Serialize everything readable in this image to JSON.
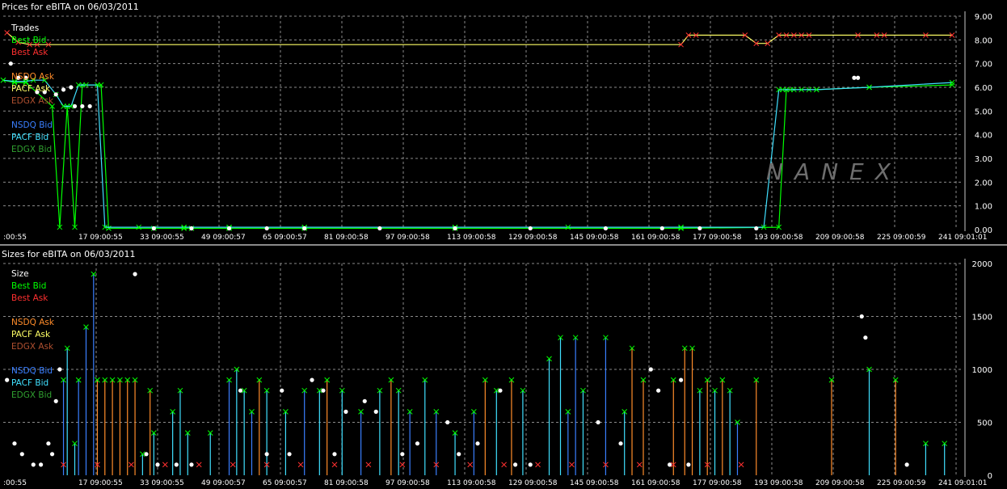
{
  "colors": {
    "trades": "#ffffff",
    "best_bid": "#00ff00",
    "best_ask": "#ff3030",
    "nsdq_ask": "#ff8c2a",
    "pacf_ask": "#ffff66",
    "edgx_ask": "#b05030",
    "nsdq_bid": "#3a7fff",
    "pacf_bid": "#40e0ff",
    "edgx_bid": "#30a030"
  },
  "watermark": "NANEX",
  "chart_data": [
    {
      "type": "line",
      "title": "Prices for  eBITA  on  06/03/2011",
      "x_ticks": [
        ":00:55",
        "17 09:00:55",
        "33 09:00:55",
        "49 09:00:57",
        "65 09:00:57",
        "81 09:00:58",
        "97 09:00:58",
        "113 09:00:58",
        "129 09:00:58",
        "145 09:00:58",
        "161 09:00:58",
        "177 09:00:58",
        "193 09:00:58",
        "209 09:00:58",
        "225 09:00:59",
        "241 09:01:01"
      ],
      "y_ticks": [
        "0.00",
        "1.00",
        "2.00",
        "3.00",
        "4.00",
        "5.00",
        "6.00",
        "7.00",
        "8.00",
        "9.00"
      ],
      "ylim": [
        0,
        9
      ],
      "xlim": [
        0,
        255
      ],
      "legend": [
        "Trades",
        "Best Bid",
        "Best Ask",
        "NSDQ Ask",
        "PACF Ask",
        "EDGX Ask",
        "NSDQ Bid",
        "PACF Bid",
        "EDGX Bid"
      ],
      "legend_placement": "top-left",
      "grid": true,
      "series": [
        {
          "name": "Best Ask",
          "x": [
            1,
            4,
            7,
            9,
            12,
            180,
            182,
            184,
            197,
            200,
            203,
            206,
            208,
            210,
            212,
            214,
            227,
            232,
            234,
            245,
            252
          ],
          "y": [
            8.3,
            7.9,
            7.8,
            7.8,
            7.8,
            7.8,
            8.2,
            8.2,
            8.2,
            7.85,
            7.85,
            8.2,
            8.2,
            8.2,
            8.2,
            8.2,
            8.2,
            8.2,
            8.2,
            8.2,
            8.2
          ]
        },
        {
          "name": "Best Bid",
          "x": [
            0,
            3,
            6,
            13,
            15,
            17,
            19,
            21,
            26,
            28,
            40,
            48,
            50,
            60,
            80,
            120,
            180,
            206,
            208,
            210,
            214,
            216,
            230,
            252
          ],
          "y": [
            6.3,
            6.2,
            6.2,
            5.2,
            0.1,
            5.2,
            0.1,
            6.1,
            6.1,
            0.05,
            0.05,
            0.05,
            0.05,
            0.05,
            0.05,
            0.05,
            0.05,
            0.1,
            5.9,
            5.9,
            5.9,
            5.9,
            6.0,
            6.1
          ]
        },
        {
          "name": "PACF Bid",
          "x": [
            0,
            3,
            6,
            8,
            11,
            14,
            16,
            18,
            20,
            22,
            25,
            27,
            36,
            48,
            60,
            80,
            120,
            150,
            180,
            202,
            206,
            207,
            209,
            212,
            216,
            230,
            252
          ],
          "y": [
            6.3,
            6.25,
            6.25,
            6.3,
            6.3,
            5.7,
            5.2,
            5.2,
            6.1,
            6.1,
            6.1,
            0.1,
            0.1,
            0.1,
            0.1,
            0.1,
            0.1,
            0.1,
            0.1,
            0.1,
            5.9,
            5.9,
            5.9,
            5.9,
            5.9,
            6.0,
            6.2
          ]
        },
        {
          "name": "Trades",
          "x": [
            2,
            4,
            6,
            9,
            11,
            14,
            16,
            18,
            19,
            21,
            23,
            40,
            50,
            60,
            70,
            80,
            100,
            120,
            140,
            160,
            175,
            185,
            200,
            226,
            227
          ],
          "y": [
            7.0,
            6.4,
            6.4,
            5.8,
            5.8,
            5.7,
            5.9,
            6.0,
            5.2,
            5.2,
            5.2,
            0.05,
            0.05,
            0.05,
            0.05,
            0.05,
            0.05,
            0.05,
            0.05,
            0.05,
            0.05,
            0.05,
            0.05,
            6.4,
            6.4
          ]
        }
      ]
    },
    {
      "type": "bar",
      "title": "Sizes for  eBITA  on  06/03/2011",
      "x_ticks": [
        ":00:55",
        "17 09:00:55",
        "33 09:00:55",
        "49 09:00:57",
        "65 09:00:57",
        "81 09:00:58",
        "97 09:00:58",
        "113 09:00:58",
        "129 09:00:58",
        "145 09:00:58",
        "161 09:00:58",
        "177 09:00:58",
        "193 09:00:58",
        "209 09:00:58",
        "225 09:00:59",
        "241 09:01:01"
      ],
      "y_ticks": [
        "0",
        "500",
        "1000",
        "1500",
        "2000"
      ],
      "ylim": [
        0,
        2000
      ],
      "xlim": [
        0,
        255
      ],
      "legend": [
        "Size",
        "Best Bid",
        "Best Ask",
        "NSDQ Ask",
        "PACF Ask",
        "EDGX Ask",
        "NSDQ Bid",
        "PACF Bid",
        "EDGX Bid"
      ],
      "legend_placement": "top-left",
      "grid": true,
      "bars": [
        {
          "x": 16,
          "y": 900,
          "s": "nsdq_bid"
        },
        {
          "x": 17,
          "y": 1200,
          "s": "pacf_bid"
        },
        {
          "x": 19,
          "y": 300,
          "s": "pacf_bid"
        },
        {
          "x": 20,
          "y": 900,
          "s": "nsdq_bid"
        },
        {
          "x": 22,
          "y": 1400,
          "s": "nsdq_bid"
        },
        {
          "x": 24,
          "y": 1900,
          "s": "nsdq_bid"
        },
        {
          "x": 25,
          "y": 900,
          "s": "nsdq_ask"
        },
        {
          "x": 27,
          "y": 900,
          "s": "nsdq_ask"
        },
        {
          "x": 29,
          "y": 900,
          "s": "nsdq_ask"
        },
        {
          "x": 31,
          "y": 900,
          "s": "nsdq_ask"
        },
        {
          "x": 33,
          "y": 900,
          "s": "nsdq_ask"
        },
        {
          "x": 35,
          "y": 900,
          "s": "nsdq_ask"
        },
        {
          "x": 37,
          "y": 200,
          "s": "pacf_bid"
        },
        {
          "x": 39,
          "y": 800,
          "s": "nsdq_ask"
        },
        {
          "x": 40,
          "y": 400,
          "s": "pacf_bid"
        },
        {
          "x": 45,
          "y": 600,
          "s": "pacf_bid"
        },
        {
          "x": 47,
          "y": 800,
          "s": "pacf_bid"
        },
        {
          "x": 49,
          "y": 400,
          "s": "pacf_bid"
        },
        {
          "x": 55,
          "y": 400,
          "s": "pacf_bid"
        },
        {
          "x": 60,
          "y": 900,
          "s": "nsdq_bid"
        },
        {
          "x": 62,
          "y": 1000,
          "s": "pacf_bid"
        },
        {
          "x": 64,
          "y": 800,
          "s": "pacf_bid"
        },
        {
          "x": 66,
          "y": 600,
          "s": "nsdq_bid"
        },
        {
          "x": 68,
          "y": 900,
          "s": "nsdq_ask"
        },
        {
          "x": 70,
          "y": 800,
          "s": "pacf_bid"
        },
        {
          "x": 75,
          "y": 600,
          "s": "pacf_bid"
        },
        {
          "x": 80,
          "y": 800,
          "s": "nsdq_bid"
        },
        {
          "x": 84,
          "y": 800,
          "s": "pacf_bid"
        },
        {
          "x": 86,
          "y": 900,
          "s": "nsdq_ask"
        },
        {
          "x": 90,
          "y": 800,
          "s": "pacf_bid"
        },
        {
          "x": 95,
          "y": 600,
          "s": "nsdq_bid"
        },
        {
          "x": 100,
          "y": 800,
          "s": "pacf_bid"
        },
        {
          "x": 103,
          "y": 900,
          "s": "nsdq_ask"
        },
        {
          "x": 105,
          "y": 800,
          "s": "pacf_bid"
        },
        {
          "x": 108,
          "y": 600,
          "s": "nsdq_bid"
        },
        {
          "x": 112,
          "y": 900,
          "s": "pacf_bid"
        },
        {
          "x": 115,
          "y": 600,
          "s": "nsdq_bid"
        },
        {
          "x": 120,
          "y": 400,
          "s": "pacf_bid"
        },
        {
          "x": 125,
          "y": 600,
          "s": "nsdq_bid"
        },
        {
          "x": 128,
          "y": 900,
          "s": "nsdq_ask"
        },
        {
          "x": 131,
          "y": 800,
          "s": "pacf_bid"
        },
        {
          "x": 135,
          "y": 900,
          "s": "nsdq_ask"
        },
        {
          "x": 138,
          "y": 800,
          "s": "pacf_bid"
        },
        {
          "x": 145,
          "y": 1100,
          "s": "pacf_bid"
        },
        {
          "x": 148,
          "y": 1300,
          "s": "pacf_bid"
        },
        {
          "x": 150,
          "y": 600,
          "s": "nsdq_bid"
        },
        {
          "x": 152,
          "y": 1300,
          "s": "nsdq_bid"
        },
        {
          "x": 154,
          "y": 800,
          "s": "pacf_bid"
        },
        {
          "x": 160,
          "y": 1300,
          "s": "nsdq_bid"
        },
        {
          "x": 165,
          "y": 600,
          "s": "pacf_bid"
        },
        {
          "x": 167,
          "y": 1200,
          "s": "nsdq_ask"
        },
        {
          "x": 170,
          "y": 900,
          "s": "nsdq_ask"
        },
        {
          "x": 178,
          "y": 900,
          "s": "nsdq_ask"
        },
        {
          "x": 181,
          "y": 1200,
          "s": "nsdq_ask"
        },
        {
          "x": 183,
          "y": 1200,
          "s": "nsdq_ask"
        },
        {
          "x": 185,
          "y": 800,
          "s": "pacf_bid"
        },
        {
          "x": 187,
          "y": 900,
          "s": "nsdq_ask"
        },
        {
          "x": 189,
          "y": 800,
          "s": "pacf_bid"
        },
        {
          "x": 191,
          "y": 900,
          "s": "nsdq_ask"
        },
        {
          "x": 193,
          "y": 800,
          "s": "pacf_bid"
        },
        {
          "x": 195,
          "y": 500,
          "s": "nsdq_bid"
        },
        {
          "x": 200,
          "y": 900,
          "s": "nsdq_ask"
        },
        {
          "x": 220,
          "y": 900,
          "s": "nsdq_ask"
        },
        {
          "x": 230,
          "y": 1000,
          "s": "pacf_bid"
        },
        {
          "x": 237,
          "y": 900,
          "s": "nsdq_ask"
        },
        {
          "x": 245,
          "y": 300,
          "s": "pacf_bid"
        },
        {
          "x": 250,
          "y": 300,
          "s": "pacf_bid"
        }
      ],
      "trades": [
        {
          "x": 1,
          "y": 900
        },
        {
          "x": 3,
          "y": 300
        },
        {
          "x": 5,
          "y": 200
        },
        {
          "x": 8,
          "y": 100
        },
        {
          "x": 10,
          "y": 100
        },
        {
          "x": 12,
          "y": 300
        },
        {
          "x": 13,
          "y": 200
        },
        {
          "x": 14,
          "y": 700
        },
        {
          "x": 15,
          "y": 1000
        },
        {
          "x": 35,
          "y": 1900
        },
        {
          "x": 38,
          "y": 200
        },
        {
          "x": 41,
          "y": 100
        },
        {
          "x": 46,
          "y": 100
        },
        {
          "x": 50,
          "y": 100
        },
        {
          "x": 63,
          "y": 800
        },
        {
          "x": 70,
          "y": 200
        },
        {
          "x": 74,
          "y": 800
        },
        {
          "x": 76,
          "y": 200
        },
        {
          "x": 82,
          "y": 900
        },
        {
          "x": 85,
          "y": 800
        },
        {
          "x": 88,
          "y": 200
        },
        {
          "x": 91,
          "y": 600
        },
        {
          "x": 96,
          "y": 700
        },
        {
          "x": 99,
          "y": 600
        },
        {
          "x": 106,
          "y": 200
        },
        {
          "x": 110,
          "y": 300
        },
        {
          "x": 118,
          "y": 500
        },
        {
          "x": 121,
          "y": 200
        },
        {
          "x": 126,
          "y": 300
        },
        {
          "x": 132,
          "y": 800
        },
        {
          "x": 136,
          "y": 100
        },
        {
          "x": 140,
          "y": 100
        },
        {
          "x": 158,
          "y": 500
        },
        {
          "x": 164,
          "y": 300
        },
        {
          "x": 172,
          "y": 1000
        },
        {
          "x": 174,
          "y": 800
        },
        {
          "x": 177,
          "y": 100
        },
        {
          "x": 180,
          "y": 900
        },
        {
          "x": 182,
          "y": 100
        },
        {
          "x": 228,
          "y": 1500
        },
        {
          "x": 229,
          "y": 1300
        },
        {
          "x": 240,
          "y": 100
        }
      ]
    }
  ],
  "price_panel": {
    "title": "Prices for  eBITA  on  06/03/2011",
    "legend": [
      "Trades",
      "Best Bid",
      "Best Ask",
      "",
      "NSDQ Ask",
      "PACF Ask",
      "EDGX Ask",
      "",
      "NSDQ Bid",
      "PACF Bid",
      "EDGX Bid"
    ]
  },
  "size_panel": {
    "title": "Sizes for  eBITA  on  06/03/2011",
    "legend": [
      "Size",
      "Best Bid",
      "Best Ask",
      "",
      "NSDQ Ask",
      "PACF Ask",
      "EDGX Ask",
      "",
      "NSDQ Bid",
      "PACF Bid",
      "EDGX Bid"
    ]
  }
}
